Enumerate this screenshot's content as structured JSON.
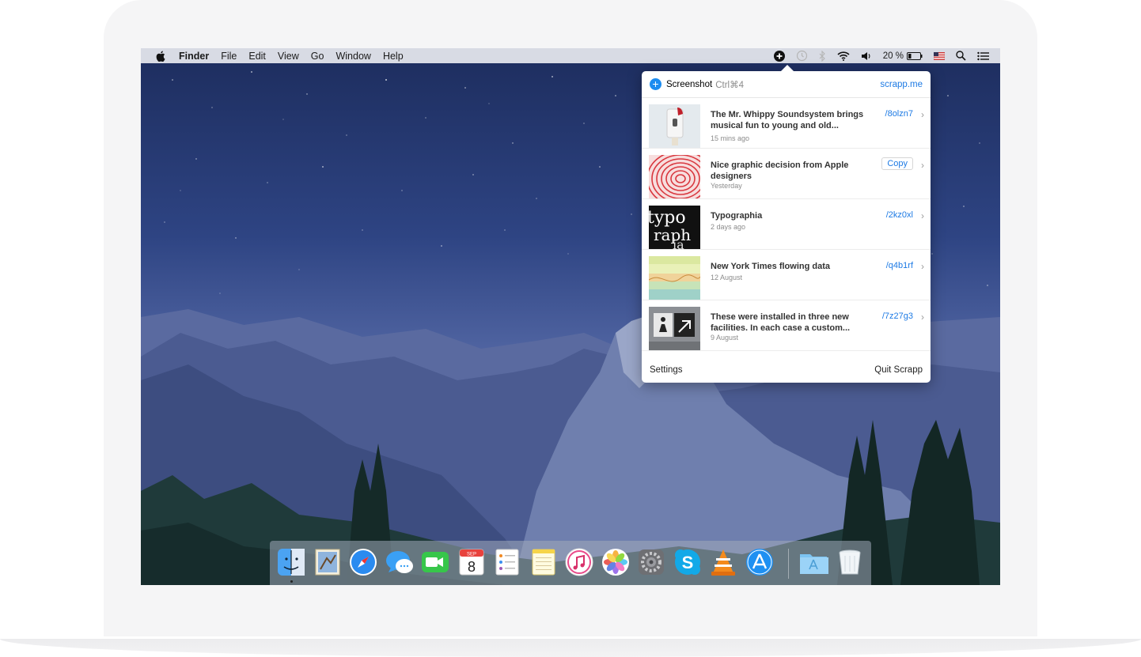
{
  "menubar": {
    "app_name": "Finder",
    "menus": [
      "File",
      "Edit",
      "View",
      "Go",
      "Window",
      "Help"
    ],
    "battery": "20 %"
  },
  "popover": {
    "header": {
      "action": "Screenshot",
      "shortcut": "Ctrl⌘4",
      "site": "scrapp.me"
    },
    "items": [
      {
        "title": "The Mr. Whippy Soundsystem brings musical fun to young and old...",
        "time": "15 mins ago",
        "link": "/8olzn7"
      },
      {
        "title": "Nice graphic decision from Apple designers",
        "time": "Yesterday",
        "button": "Copy"
      },
      {
        "title": "Typographia",
        "time": "2 days ago",
        "link": "/2kz0xl"
      },
      {
        "title": "New York Times flowing data",
        "time": "12 August",
        "link": "/q4b1rf"
      },
      {
        "title": "These were installed in three new facilities. In each case a custom...",
        "time": "9 August",
        "link": "/7z27g3"
      }
    ],
    "footer": {
      "settings": "Settings",
      "quit": "Quit Scrapp"
    }
  },
  "dock": {
    "apps": [
      "Finder",
      "Mail",
      "Safari",
      "Messages",
      "FaceTime",
      "Calendar",
      "Reminders",
      "Notes",
      "iTunes",
      "Photos",
      "System Preferences",
      "Skype",
      "VLC",
      "App Store",
      "Applications",
      "Trash"
    ],
    "calendar": {
      "month": "SEP",
      "day": "8"
    }
  },
  "colors": {
    "accent": "#1d7ae4",
    "sky_top": "#1d2d5e",
    "sky_bottom": "#6c7fb8"
  }
}
